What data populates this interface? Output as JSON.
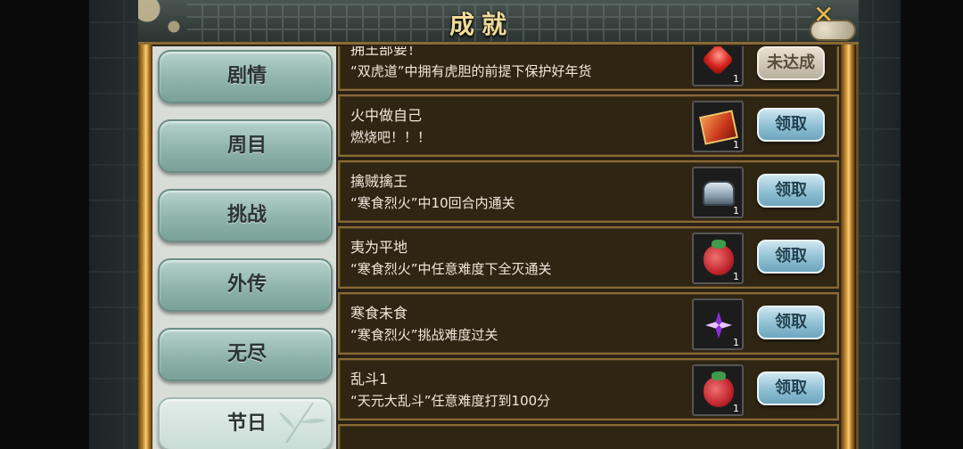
{
  "window": {
    "title": "成就"
  },
  "sidebar": {
    "items": [
      {
        "label": "剧情",
        "active": false
      },
      {
        "label": "周目",
        "active": false
      },
      {
        "label": "挑战",
        "active": false
      },
      {
        "label": "外传",
        "active": false
      },
      {
        "label": "无尽",
        "active": false
      },
      {
        "label": "节日",
        "active": true
      }
    ]
  },
  "achievements": [
    {
      "title": "拥王部要！",
      "desc": "“双虎道”中拥有虎胆的前提下保护好年货",
      "reward_icon": "red-gem-icon",
      "reward_count": "1",
      "button": "未达成",
      "claimable": false
    },
    {
      "title": "火中做自己",
      "desc": "燃烧吧！！！",
      "reward_icon": "fire-book-icon",
      "reward_count": "1",
      "button": "领取",
      "claimable": true
    },
    {
      "title": "擒贼擒王",
      "desc": "“寒食烈火”中10回合内通关",
      "reward_icon": "silver-chest-icon",
      "reward_count": "1",
      "button": "领取",
      "claimable": true
    },
    {
      "title": "夷为平地",
      "desc": "“寒食烈火”中任意难度下全灭通关",
      "reward_icon": "red-pouch-icon",
      "reward_count": "1",
      "button": "领取",
      "claimable": true
    },
    {
      "title": "寒食未食",
      "desc": "“寒食烈火”挑战难度过关",
      "reward_icon": "purple-star-icon",
      "reward_count": "1",
      "button": "领取",
      "claimable": true
    },
    {
      "title": "乱斗1",
      "desc": "“天元大乱斗”任意难度打到100分",
      "reward_icon": "red-pouch-icon",
      "reward_count": "1",
      "button": "领取",
      "claimable": true
    }
  ],
  "colors": {
    "accent_gold": "#d49a3a",
    "button_teal": "#8fb4aa",
    "button_blue": "#8fbfd3"
  }
}
